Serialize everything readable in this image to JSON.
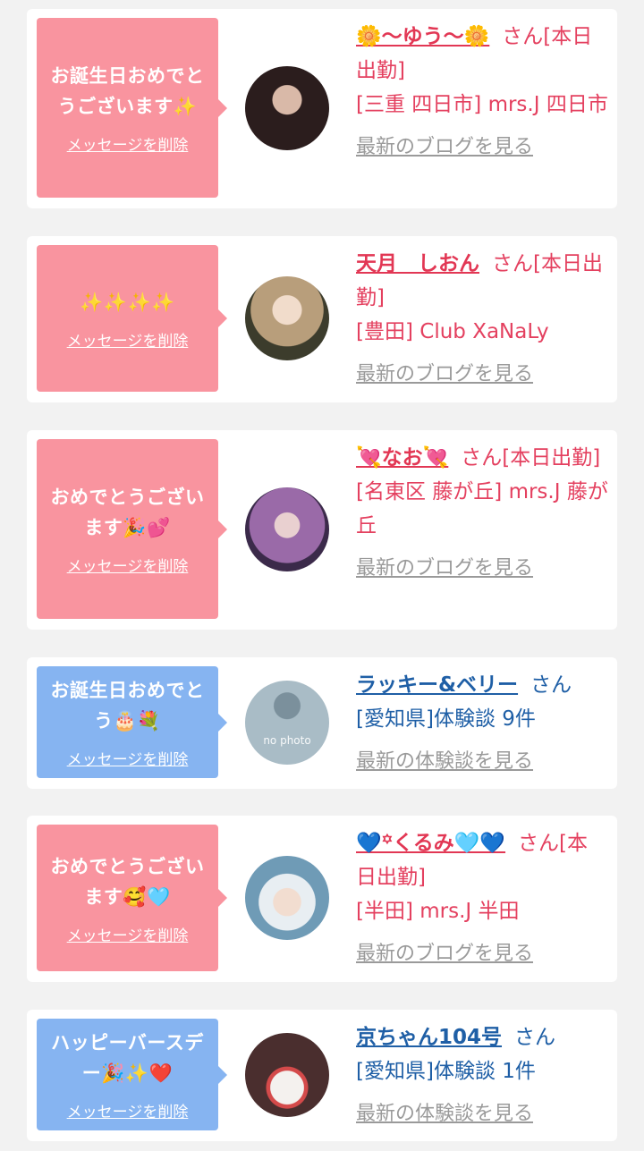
{
  "cards": [
    {
      "name": "🌼〜ゆう〜🌼",
      "san": "さん[本日出勤]",
      "shop": "[三重 四日市] mrs.J 四日市",
      "latest": "最新のブログを見る",
      "message": "お誕生日おめでとうございます✨",
      "delete": "メッセージを削除",
      "theme": "pink",
      "avatar_color": "#3a2a2a"
    },
    {
      "name": "天月　しおん",
      "san": "さん[本日出勤]",
      "shop": "[豊田] Club XaNaLy",
      "latest": "最新のブログを見る",
      "message": "✨✨✨✨",
      "delete": "メッセージを削除",
      "theme": "pink",
      "avatar_color": "#c9b59a"
    },
    {
      "name": "💘なお💘",
      "san": "さん[本日出勤]",
      "shop": "[名東区 藤が丘] mrs.J 藤が丘",
      "latest": "最新のブログを見る",
      "message": "おめでとうございます🎉💕",
      "delete": "メッセージを削除",
      "theme": "pink",
      "avatar_color": "#8a5a9a"
    },
    {
      "name": "ラッキー&ベリー",
      "san": "さん",
      "shop": "[愛知県]体験談 9件",
      "latest": "最新の体験談を見る",
      "message": "お誕生日おめでとう🎂💐",
      "delete": "メッセージを削除",
      "theme": "blue",
      "avatar_color": "#9fb3bf",
      "avatar_text": "no photo"
    },
    {
      "name": "💙꙳くるみ🩵💙",
      "san": "さん[本日出勤]",
      "shop": "[半田] mrs.J 半田",
      "latest": "最新のブログを見る",
      "message": "おめでとうございます🥰🩵",
      "delete": "メッセージを削除",
      "theme": "pink",
      "avatar_color": "#7fa7c0"
    },
    {
      "name": "京ちゃん104号",
      "san": "さん",
      "shop": "[愛知県]体験談 1件",
      "latest": "最新の体験談を見る",
      "message": "ハッピーバースデー🎉✨❤️",
      "delete": "メッセージを削除",
      "theme": "blue",
      "avatar_color": "#5a3a3a"
    }
  ]
}
